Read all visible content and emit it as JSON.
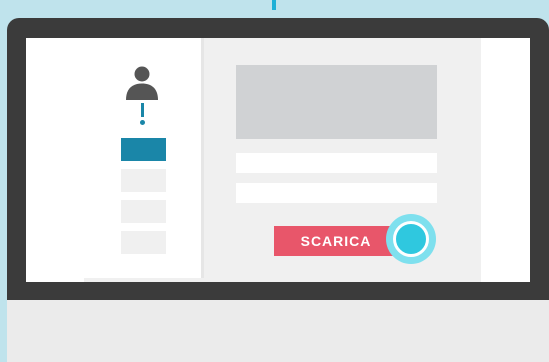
{
  "colors": {
    "background": "#bfe3ec",
    "laptop_frame": "#3b3b3b",
    "accent": "#1a86a8",
    "button": "#e8566a",
    "cursor": "#2fc8df"
  },
  "sidebar": {
    "avatar_icon": "user-silhouette-icon",
    "alert_icon": "exclamation-icon",
    "items": [
      {
        "active": true
      },
      {
        "active": false
      },
      {
        "active": false
      },
      {
        "active": false
      }
    ]
  },
  "main": {
    "download_button_label": "SCARICA"
  },
  "cursor_icon": "click-cursor-icon"
}
